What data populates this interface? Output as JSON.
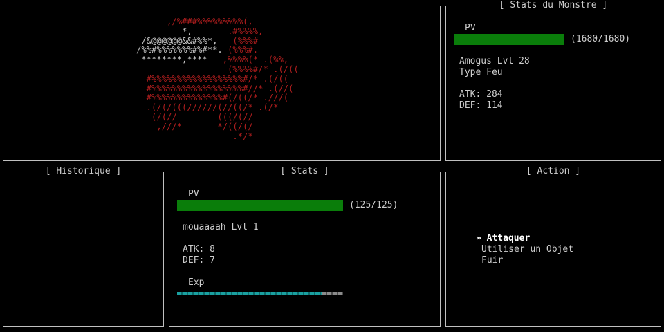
{
  "monster_art": {
    "color_primary": "#b01e1e",
    "color_secondary": "#c8c8c8",
    "lines": [
      {
        "segments": [
          {
            "text": "         ,/%###%%%%%%%%%(,",
            "color": "primary"
          }
        ]
      },
      {
        "segments": [
          {
            "text": "            *,",
            "color": "secondary"
          },
          {
            "text": "       .#%%%%,",
            "color": "primary"
          }
        ]
      },
      {
        "segments": [
          {
            "text": "    /&@@@@@@&&#%%*,",
            "color": "secondary"
          },
          {
            "text": "   (%%%#",
            "color": "primary"
          }
        ]
      },
      {
        "segments": [
          {
            "text": "   /%%#%%%%%%%#%#**.",
            "color": "secondary"
          },
          {
            "text": " (%%%#.",
            "color": "primary"
          }
        ]
      },
      {
        "segments": [
          {
            "text": "    ********,****",
            "color": "secondary"
          },
          {
            "text": "   ,%%%%(* .(%%,",
            "color": "primary"
          }
        ]
      },
      {
        "segments": [
          {
            "text": "                     (%%%%#/* .(/((",
            "color": "primary"
          }
        ]
      },
      {
        "segments": [
          {
            "text": "     #%%%%%%%%%%%%%%%%%%#/* .(/((",
            "color": "primary"
          }
        ]
      },
      {
        "segments": [
          {
            "text": "     #%%%%%%%%%%%%%%%%%%#//* .(//(",
            "color": "primary"
          }
        ]
      },
      {
        "segments": [
          {
            "text": "     #%%%%%%%%%%%%%%#(/((/* .///(",
            "color": "primary"
          }
        ]
      },
      {
        "segments": [
          {
            "text": "     .(/(/(((//////(//((/* .(/*",
            "color": "primary"
          }
        ]
      },
      {
        "segments": [
          {
            "text": "      (/(//        (((/(//",
            "color": "primary"
          }
        ]
      },
      {
        "segments": [
          {
            "text": "       ,///*       */((/(/",
            "color": "primary"
          }
        ]
      },
      {
        "segments": [
          {
            "text": "                      .*/*",
            "color": "primary"
          }
        ]
      }
    ]
  },
  "monster_stats": {
    "title": "[ Stats du Monstre ]",
    "hp_label": "PV",
    "hp_current": 1680,
    "hp_max": 1680,
    "hp_text": "(1680/1680)",
    "name_level": "Amogus Lvl 28",
    "type": "Type Feu",
    "atk": "ATK: 284",
    "def": "DEF: 114"
  },
  "history": {
    "title": "[ Historique ]"
  },
  "player_stats": {
    "title": "[ Stats ]",
    "hp_label": "PV",
    "hp_current": 125,
    "hp_max": 125,
    "hp_text": "(125/125)",
    "name_level": "mouaaaah Lvl 1",
    "atk": "ATK: 8",
    "def": "DEF: 7",
    "exp_label": "Exp",
    "exp_fraction": 0.87
  },
  "action": {
    "title": "[ Action ]",
    "items": [
      {
        "label": "» Attaquer",
        "selected": true
      },
      {
        "label": "Utiliser un Objet",
        "selected": false
      },
      {
        "label": "Fuir",
        "selected": false
      }
    ]
  },
  "colors": {
    "hp_bar": "#0a7d0a",
    "border": "#c0c0c0",
    "text": "#cccccc"
  }
}
